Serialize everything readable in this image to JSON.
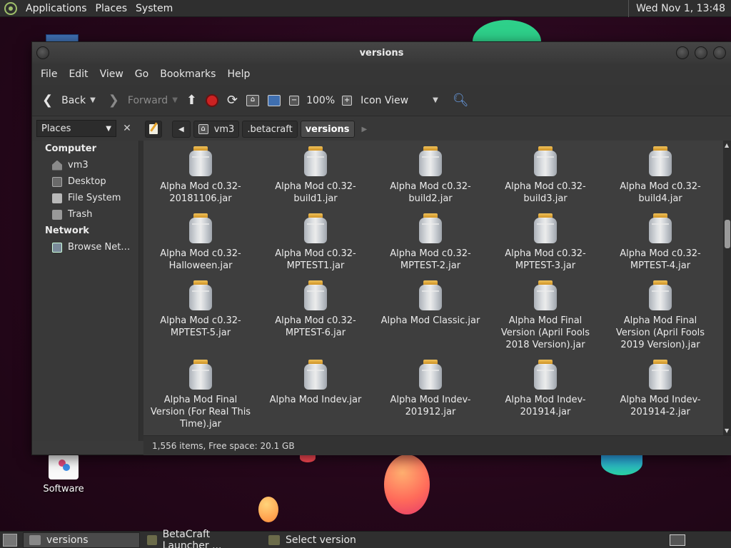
{
  "top_panel": {
    "menus": [
      "Applications",
      "Places",
      "System"
    ],
    "clock": "Wed Nov 1, 13:48"
  },
  "desktop": {
    "software_label": "Software"
  },
  "window": {
    "title": "versions",
    "menubar": [
      "File",
      "Edit",
      "View",
      "Go",
      "Bookmarks",
      "Help"
    ],
    "toolbar": {
      "back": "Back",
      "forward": "Forward",
      "zoom": "100%",
      "view_mode": "Icon View"
    },
    "location": {
      "places_label": "Places",
      "breadcrumbs": [
        "vm3",
        ".betacraft",
        "versions"
      ]
    },
    "sidebar": {
      "computer_header": "Computer",
      "computer_items": [
        "vm3",
        "Desktop",
        "File System",
        "Trash"
      ],
      "network_header": "Network",
      "network_items": [
        "Browse Net…"
      ]
    },
    "files": [
      "Alpha Mod c0.32-20181106.jar",
      "Alpha Mod c0.32-build1.jar",
      "Alpha Mod c0.32-build2.jar",
      "Alpha Mod c0.32-build3.jar",
      "Alpha Mod c0.32-build4.jar",
      "Alpha Mod c0.32-Halloween.jar",
      "Alpha Mod c0.32-MPTEST1.jar",
      "Alpha Mod c0.32-MPTEST-2.jar",
      "Alpha Mod c0.32-MPTEST-3.jar",
      "Alpha Mod c0.32-MPTEST-4.jar",
      "Alpha Mod c0.32-MPTEST-5.jar",
      "Alpha Mod c0.32-MPTEST-6.jar",
      "Alpha Mod Classic.jar",
      "Alpha Mod Final Version (April Fools 2018 Version).jar",
      "Alpha Mod Final Version (April Fools 2019 Version).jar",
      "Alpha Mod Final Version (For Real This Time).jar",
      "Alpha Mod Indev.jar",
      "Alpha Mod Indev-201912.jar",
      "Alpha Mod Indev-201914.jar",
      "Alpha Mod Indev-201914-2.jar"
    ],
    "status": "1,556 items, Free space: 20.1 GB",
    "scroll_fraction": 0.28
  },
  "taskbar": {
    "tasks": [
      "versions",
      "BetaCraft Launcher ...",
      "Select version"
    ]
  }
}
